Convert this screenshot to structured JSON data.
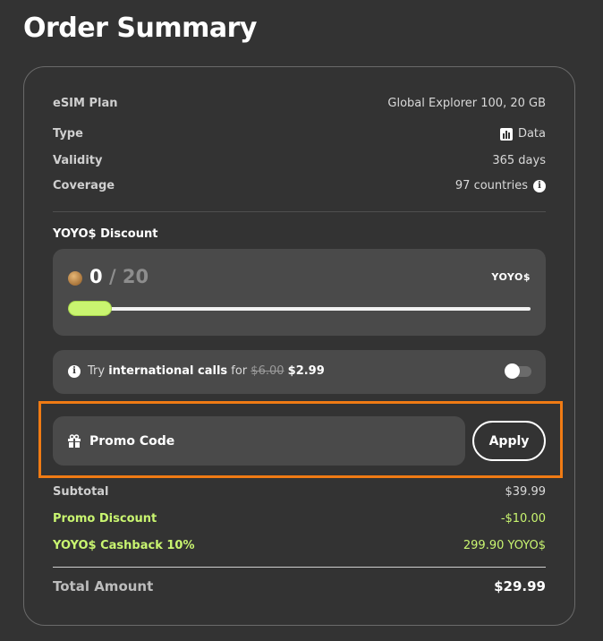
{
  "header": {
    "title": "Order Summary"
  },
  "plan": {
    "esim_plan": {
      "label": "eSIM Plan",
      "value": "Global Explorer 100, 20 GB"
    },
    "type": {
      "label": "Type",
      "value": "Data",
      "icon": "bar-chart-icon"
    },
    "validity": {
      "label": "Validity",
      "value": "365 days"
    },
    "coverage": {
      "label": "Coverage",
      "value": "97 countries",
      "icon": "info-icon"
    }
  },
  "yoyo_discount": {
    "label": "YOYO$ Discount",
    "current": "0",
    "separator": "/",
    "max": "20",
    "unit": "YOYO$",
    "slider_value": 0,
    "accent_color": "#c9f570"
  },
  "calls_offer": {
    "prefix": "Try",
    "highlight": "international calls",
    "middle": "for",
    "old_price": "$6.00",
    "new_price": "$2.99",
    "toggle_on": false
  },
  "promo": {
    "placeholder": "Promo Code",
    "apply_label": "Apply",
    "highlight_color": "#f07b14"
  },
  "totals": {
    "subtotal": {
      "label": "Subtotal",
      "value": "$39.99"
    },
    "promo_discount": {
      "label": "Promo Discount",
      "value": "-$10.00"
    },
    "cashback": {
      "label": "YOYO$ Cashback 10%",
      "value": "299.90 YOYO$"
    },
    "total": {
      "label": "Total Amount",
      "value": "$29.99"
    }
  }
}
